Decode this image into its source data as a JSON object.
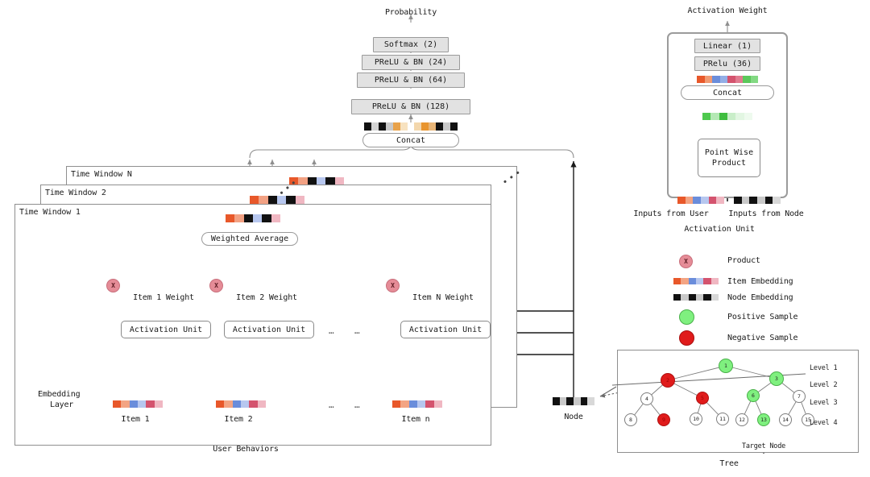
{
  "top_stack": {
    "output_label": "Probability",
    "layers": [
      {
        "label": "Softmax (2)"
      },
      {
        "label": "PReLU & BN (24)"
      },
      {
        "label": "PReLU & BN (64)"
      },
      {
        "label": "PReLU & BN (128)"
      }
    ],
    "concat_label": "Concat"
  },
  "time_windows": [
    {
      "label": "Time Window N"
    },
    {
      "label": "Time Window 2"
    },
    {
      "label": "Time Window 1"
    }
  ],
  "main_panel": {
    "weighted_average_label": "Weighted Average",
    "product_symbol": "X",
    "item_weights": [
      "Item 1 Weight",
      "Item 2 Weight",
      "Item N Weight"
    ],
    "activation_unit_label": "Activation Unit",
    "items": [
      "Item 1",
      "Item 2",
      "Item n"
    ],
    "ellipsis": "…",
    "embedding_layer_label_line1": "Embedding",
    "embedding_layer_label_line2": "Layer",
    "user_behaviors_label": "User Behaviors",
    "node_label": "Node"
  },
  "activation_unit_detail": {
    "title": "Activation Weight",
    "caption": "Activation Unit",
    "linear_label": "Linear (1)",
    "prelu_label": "PRelu (36)",
    "concat_label": "Concat",
    "product_label_line1": "Point Wise",
    "product_label_line2": "Product",
    "input_user_label": "Inputs from User",
    "input_node_label": "Inputs from Node"
  },
  "legend": {
    "items": [
      {
        "label": "Product",
        "type": "product",
        "color": "#e58c97"
      },
      {
        "label": "Item Embedding",
        "type": "item-embedding"
      },
      {
        "label": "Node Embedding",
        "type": "node-embedding"
      },
      {
        "label": "Positive Sample",
        "type": "circle",
        "color": "#7ff07f"
      },
      {
        "label": "Negative Sample",
        "type": "circle",
        "color": "#e01b1b"
      }
    ]
  },
  "tree": {
    "caption": "Tree",
    "target_label": "Target Node",
    "levels": [
      "Level 1",
      "Level 2",
      "Level 3",
      "Level 4"
    ],
    "nodes": [
      {
        "id": "1",
        "level": 1,
        "state": "positive"
      },
      {
        "id": "2",
        "level": 2,
        "state": "negative"
      },
      {
        "id": "3",
        "level": 2,
        "state": "positive"
      },
      {
        "id": "4",
        "level": 3,
        "state": "normal"
      },
      {
        "id": "5",
        "level": 3,
        "state": "negative"
      },
      {
        "id": "6",
        "level": 3,
        "state": "positive"
      },
      {
        "id": "7",
        "level": 3,
        "state": "normal"
      },
      {
        "id": "8",
        "level": 4,
        "state": "normal"
      },
      {
        "id": "9",
        "level": 4,
        "state": "negative"
      },
      {
        "id": "10",
        "level": 4,
        "state": "normal"
      },
      {
        "id": "11",
        "level": 4,
        "state": "normal"
      },
      {
        "id": "12",
        "level": 4,
        "state": "normal"
      },
      {
        "id": "13",
        "level": 4,
        "state": "positive"
      },
      {
        "id": "14",
        "level": 4,
        "state": "normal"
      },
      {
        "id": "15",
        "level": 4,
        "state": "normal"
      }
    ]
  },
  "colors": {
    "item_embedding": [
      "#e8582a",
      "#f3a483",
      "#6a8ddb",
      "#b7c7ef",
      "#d4536e",
      "#f0b7c2"
    ],
    "node_embedding": [
      "#111111",
      "#c9c9c9",
      "#111111",
      "#c9c9c9",
      "#111111",
      "#d8d8d8"
    ],
    "concat_bar": [
      "#111111",
      "#d4d4d4",
      "#111111",
      "#c9c9c9",
      "#e8a24a",
      "#f7e2c0",
      "#ffffff",
      "#f3d7ad",
      "#e8952f",
      "#e9b678",
      "#111111",
      "#c9c9c9",
      "#111111"
    ],
    "au_concat_bar": [
      "#e8582a",
      "#f09a72",
      "#6a8ddb",
      "#93aee6",
      "#d4536e",
      "#e07b8f",
      "#5bc85b",
      "#83d983"
    ],
    "green_bar": [
      "#4ec94e",
      "#b4e8b4",
      "#3ebd3e",
      "#c9eec9",
      "#e2f6e2",
      "#eefaee"
    ],
    "positive": "#7ff07f",
    "negative": "#e01b1b",
    "product": "#e58c97",
    "line": "#8f8f8f",
    "line_dark": "#222222"
  }
}
